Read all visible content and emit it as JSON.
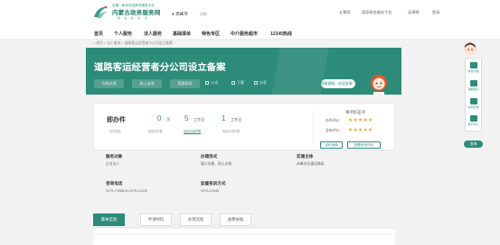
{
  "header": {
    "logo_line1": "全国一体化在线政务服务平台",
    "logo_line2": "内蒙古政务服务网",
    "logo_line3": "蒙 古 文 标 识",
    "city": "赤峰市",
    "city_switch": "切换",
    "links": [
      "长辈版",
      "国家政务服务平台",
      "无障碍",
      "登录"
    ]
  },
  "nav": [
    "首页",
    "个人服务",
    "法人服务",
    "基础清单",
    "特色专区",
    "中介服务超市",
    "12345热线"
  ],
  "breadcrumb": "> 首页 > 法人服务 > 道路客运经营者分公司设立备案",
  "banner": {
    "title": "道路客运经营者分公司设立备案",
    "buttons": [
      "在线办理",
      "网上咨询",
      "我要投诉"
    ],
    "stats": [
      {
        "icon": "view-icon",
        "label": "12次"
      },
      {
        "icon": "download-icon",
        "label": "下载"
      },
      {
        "icon": "share-icon",
        "label": "分享"
      }
    ],
    "bubble": "智能客服，欢迎咨询！"
  },
  "summary": {
    "type_label": "即办件",
    "type_sub": "办件类型",
    "visits_num": "0",
    "visits_unit": "次",
    "visits_sub": "到现场次数",
    "legal_num": "5",
    "legal_unit": "工作日",
    "legal_link": "法定办结时限",
    "promise_num": "1",
    "promise_unit": "工作日",
    "promise_sub": "承诺办结时限",
    "rating_title": "事项好差评",
    "ratings": [
      {
        "label": "办件评价：",
        "stars": 5
      },
      {
        "label": "咨询评价：",
        "stars": 5
      }
    ],
    "buttons": [
      "评价指南",
      "查看所有评价"
    ]
  },
  "info": [
    {
      "key": "服务对象",
      "value": "企业法人"
    },
    {
      "key": "办理形式",
      "value": "窗口办理、网上办理"
    },
    {
      "key": "实施主体",
      "value": "赤峰市交通运输局"
    },
    {
      "key": "咨询电话",
      "value": "0475-7938816,0475-12345"
    },
    {
      "key": "监督投诉方式",
      "value": "0475-12345"
    }
  ],
  "tabs": [
    "基本信息",
    "申请材料",
    "办理流程",
    "收费依据"
  ],
  "sidebar": {
    "items": [
      "常见问题",
      "我要提问",
      "办件查询",
      "用户中心"
    ],
    "consult_button": "咨询"
  },
  "colors": {
    "brand": "#2d8b7a",
    "star": "#f5a623"
  }
}
